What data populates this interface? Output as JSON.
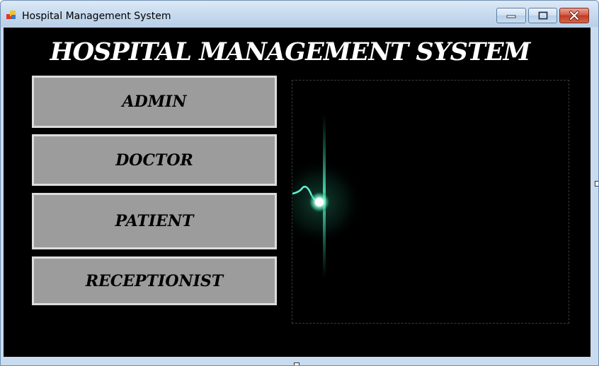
{
  "window": {
    "title": "Hospital Management System",
    "controls": {
      "minimize_icon": "minimize-icon",
      "maximize_icon": "maximize-icon",
      "close_icon": "close-icon"
    }
  },
  "form": {
    "heading": "HOSPITAL MANAGEMENT SYSTEM",
    "buttons": [
      {
        "label": "ADMIN"
      },
      {
        "label": "DOCTOR"
      },
      {
        "label": "PATIENT"
      },
      {
        "label": "RECEPTIONIST"
      }
    ],
    "picture": {
      "icon": "heartbeat-glow-image"
    }
  },
  "colors": {
    "background": "#000000",
    "button_fill": "#9c9c9c",
    "button_border": "#dcdcdc",
    "heading_text": "#ffffff",
    "glow": "#36e0b0"
  }
}
